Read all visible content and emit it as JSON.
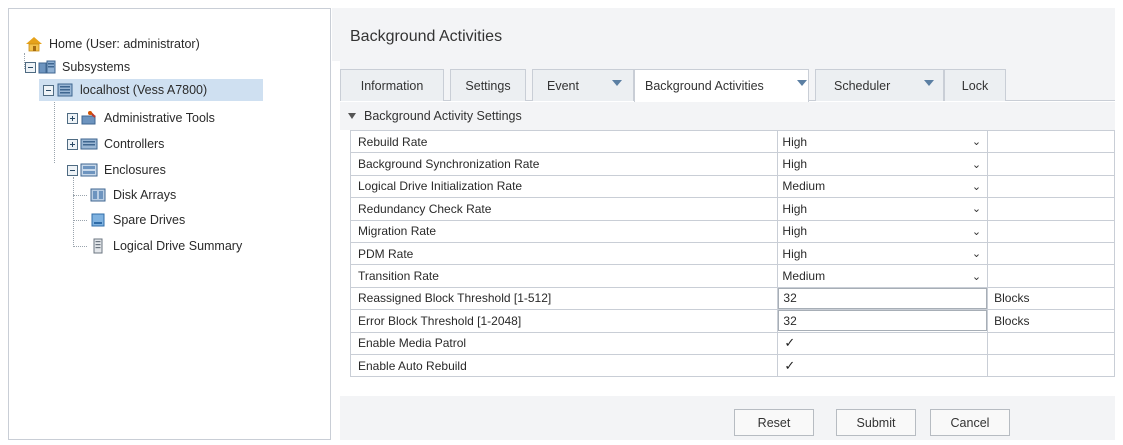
{
  "tree": {
    "home": "Home (User: administrator)",
    "subsystems": "Subsystems",
    "host": "localhost (Vess A7800)",
    "admin_tools": "Administrative Tools",
    "controllers": "Controllers",
    "enclosures": "Enclosures",
    "disk_arrays": "Disk Arrays",
    "spare_drives": "Spare Drives",
    "logical_drive_summary": "Logical Drive Summary"
  },
  "page": {
    "title": "Background Activities"
  },
  "tabs": [
    {
      "label": "Information"
    },
    {
      "label": "Settings"
    },
    {
      "label": "Event"
    },
    {
      "label": "Background Activities"
    },
    {
      "label": "Scheduler"
    },
    {
      "label": "Lock"
    }
  ],
  "section": {
    "title": "Background Activity Settings"
  },
  "settings": [
    {
      "label": "Rebuild Rate",
      "value": "High"
    },
    {
      "label": "Background Synchronization Rate",
      "value": "High"
    },
    {
      "label": "Logical Drive Initialization Rate",
      "value": "Medium"
    },
    {
      "label": "Redundancy Check Rate",
      "value": "High"
    },
    {
      "label": "Migration Rate",
      "value": "High"
    },
    {
      "label": "PDM Rate",
      "value": "High"
    },
    {
      "label": "Transition Rate",
      "value": "Medium"
    },
    {
      "label": "Reassigned Block Threshold [1-512]",
      "value": "32",
      "unit": "Blocks"
    },
    {
      "label": "Error Block Threshold [1-2048]",
      "value": "32",
      "unit": "Blocks"
    },
    {
      "label": "Enable Media Patrol",
      "checked": true
    },
    {
      "label": "Enable Auto Rebuild",
      "checked": true
    }
  ],
  "buttons": {
    "reset": "Reset",
    "submit": "Submit",
    "cancel": "Cancel"
  },
  "glyphs": {
    "dropdown": "⌄",
    "check": "✓"
  },
  "colors": {
    "selected_row": "#cfe0f1",
    "tab_arrow": "#5b7fa3",
    "panel_bg": "#f3f4f6"
  }
}
